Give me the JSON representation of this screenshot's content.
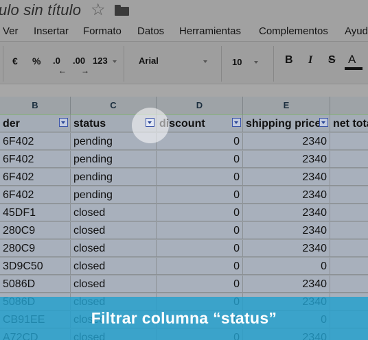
{
  "window": {
    "doc_title": "ulo sin título"
  },
  "menu": {
    "items": [
      "Ver",
      "Insertar",
      "Formato",
      "Datos",
      "Herramientas",
      "Complementos",
      "Ayud"
    ]
  },
  "toolbar": {
    "euro": "€",
    "percent": "%",
    "dec_less": ".0",
    "dec_more": ".00",
    "number_format": "123",
    "font": "Arial",
    "font_size": "10",
    "bold": "B",
    "italic": "I",
    "strike": "S",
    "text_color": "A"
  },
  "columns": [
    "B",
    "C",
    "D",
    "E"
  ],
  "headers": [
    "der",
    "status",
    "discount",
    "shipping price",
    "net tota"
  ],
  "rows": [
    [
      "6F402",
      "pending",
      "0",
      "2340"
    ],
    [
      "6F402",
      "pending",
      "0",
      "2340"
    ],
    [
      "6F402",
      "pending",
      "0",
      "2340"
    ],
    [
      "6F402",
      "pending",
      "0",
      "2340"
    ],
    [
      "45DF1",
      "closed",
      "0",
      "2340"
    ],
    [
      "280C9",
      "closed",
      "0",
      "2340"
    ],
    [
      "280C9",
      "closed",
      "0",
      "2340"
    ],
    [
      "3D9C50",
      "closed",
      "0",
      "0"
    ],
    [
      "5086D",
      "closed",
      "0",
      "2340"
    ],
    [
      "5086D",
      "closed",
      "0",
      "2340"
    ],
    [
      "CB91EE",
      "closed",
      "0",
      "0"
    ],
    [
      "A72CD",
      "closed",
      "0",
      "2340"
    ]
  ],
  "banner": {
    "text": "Filtrar columna “status”"
  },
  "colors": {
    "banner": "#23a0cd",
    "filter_button": "#3b55a9"
  }
}
